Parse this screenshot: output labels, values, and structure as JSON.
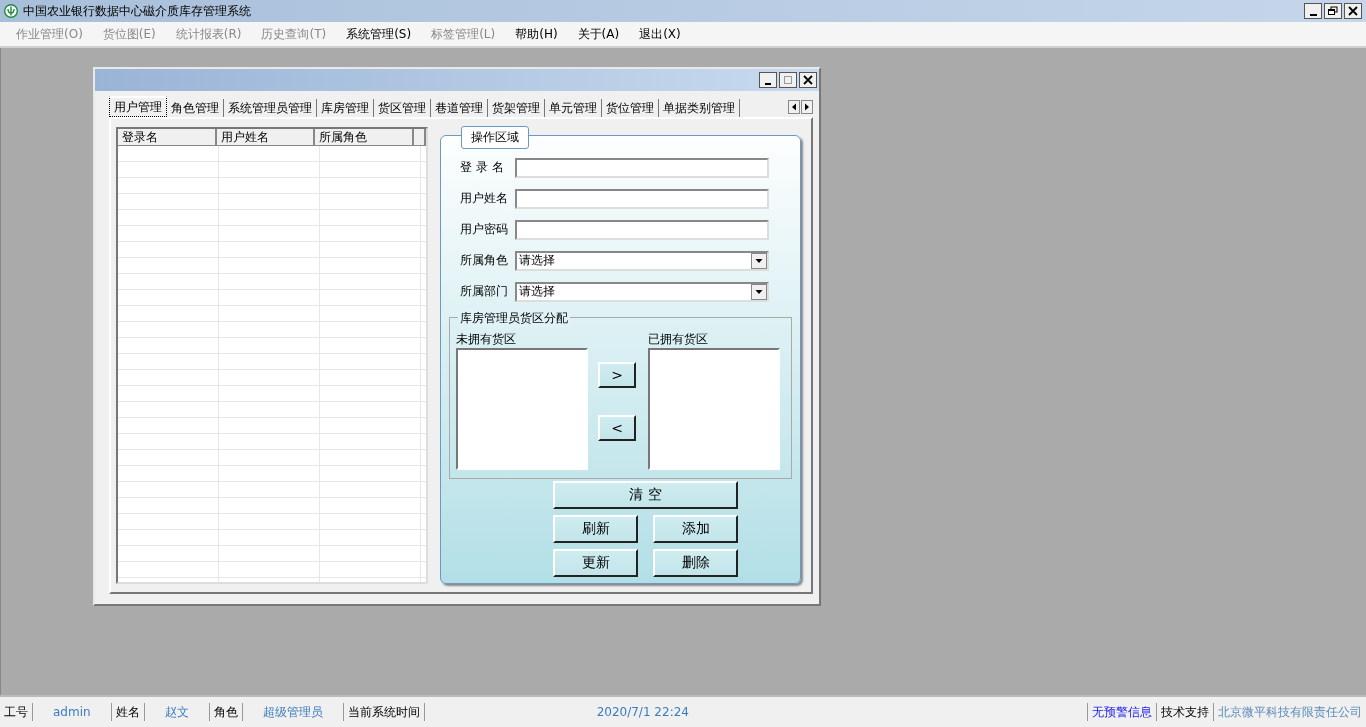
{
  "window": {
    "title": "中国农业银行数据中心磁介质库存管理系统"
  },
  "menu": [
    {
      "label": "作业管理(O)",
      "disabled": true
    },
    {
      "label": "货位图(E)",
      "disabled": true
    },
    {
      "label": "统计报表(R)",
      "disabled": true
    },
    {
      "label": "历史查询(T)",
      "disabled": true
    },
    {
      "label": "系统管理(S)",
      "disabled": false
    },
    {
      "label": "标签管理(L)",
      "disabled": true
    },
    {
      "label": "帮助(H)",
      "disabled": false
    },
    {
      "label": "关于(A)",
      "disabled": false
    },
    {
      "label": "退出(X)",
      "disabled": false
    }
  ],
  "child_window": {
    "tabs": [
      {
        "label": "用户管理",
        "selected": true
      },
      {
        "label": "角色管理",
        "selected": false
      },
      {
        "label": "系统管理员管理",
        "selected": false
      },
      {
        "label": "库房管理",
        "selected": false
      },
      {
        "label": "货区管理",
        "selected": false
      },
      {
        "label": "巷道管理",
        "selected": false
      },
      {
        "label": "货架管理",
        "selected": false
      },
      {
        "label": "单元管理",
        "selected": false
      },
      {
        "label": "货位管理",
        "selected": false
      },
      {
        "label": "单据类别管理",
        "selected": false
      }
    ],
    "grid": {
      "columns": [
        "登录名",
        "用户姓名",
        "所属角色"
      ]
    },
    "operation_area": {
      "title": "操作区域",
      "fields": [
        {
          "label": "登 录 名",
          "kind": "text"
        },
        {
          "label": "用户姓名",
          "kind": "text"
        },
        {
          "label": "用户密码",
          "kind": "text"
        },
        {
          "label": "所属角色",
          "kind": "select",
          "value": "请选择"
        },
        {
          "label": "所属部门",
          "kind": "select",
          "value": "请选择"
        }
      ],
      "allocation": {
        "title": "库房管理员货区分配",
        "available_label": "未拥有货区",
        "owned_label": "已拥有货区",
        "move_right": ">",
        "move_left": "<"
      },
      "buttons": [
        {
          "label": "清 空",
          "kind": "wide"
        },
        {
          "label": "刷新",
          "kind": "half"
        },
        {
          "label": "添加",
          "kind": "half"
        },
        {
          "label": "更新",
          "kind": "half"
        },
        {
          "label": "删除",
          "kind": "half"
        }
      ]
    }
  },
  "status_bar": [
    {
      "text": "工号",
      "kind": "label"
    },
    {
      "text": "admin",
      "kind": "value"
    },
    {
      "text": "姓名",
      "kind": "label"
    },
    {
      "text": "赵文",
      "kind": "value"
    },
    {
      "text": "角色",
      "kind": "label"
    },
    {
      "text": "超级管理员",
      "kind": "value"
    },
    {
      "text": "当前系统时间",
      "kind": "label"
    },
    {
      "text": "2020/7/1 22:24",
      "kind": "time"
    },
    {
      "text": "无预警信息",
      "kind": "alert"
    },
    {
      "text": "技术支持",
      "kind": "label"
    },
    {
      "text": "北京微平科技有限责任公司",
      "kind": "company"
    }
  ]
}
